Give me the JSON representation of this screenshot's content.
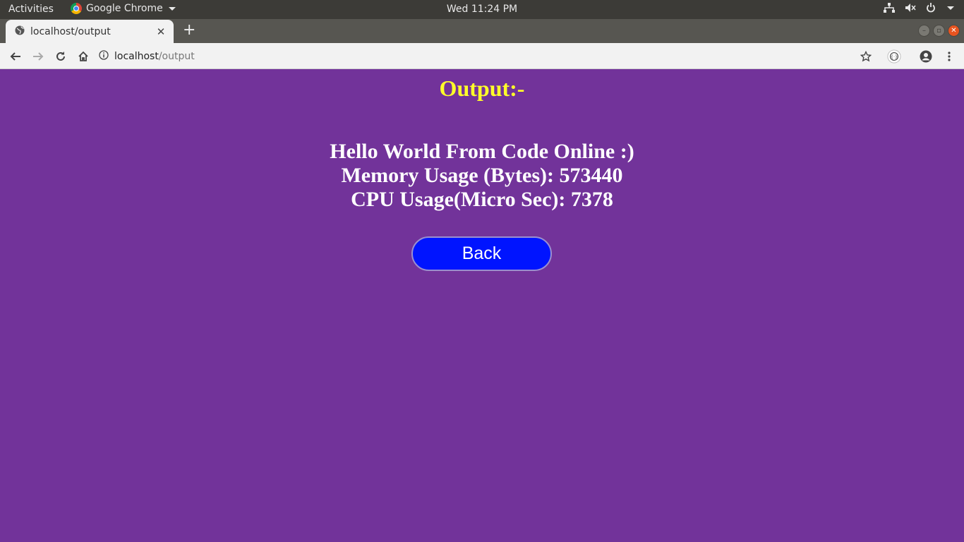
{
  "os_bar": {
    "activities": "Activities",
    "app_name": "Google Chrome",
    "clock": "Wed 11:24 PM"
  },
  "browser": {
    "tab_title": "localhost/output",
    "url_host": "localhost",
    "url_path": "/output"
  },
  "page": {
    "heading": "Output:-",
    "lines": [
      "Hello World From Code Online :)",
      "Memory Usage (Bytes): 573440",
      "CPU Usage(Micro Sec): 7378"
    ],
    "back_label": "Back"
  },
  "colors": {
    "page_background": "#72339a",
    "heading": "#ffff29",
    "button": "#0014ff"
  }
}
